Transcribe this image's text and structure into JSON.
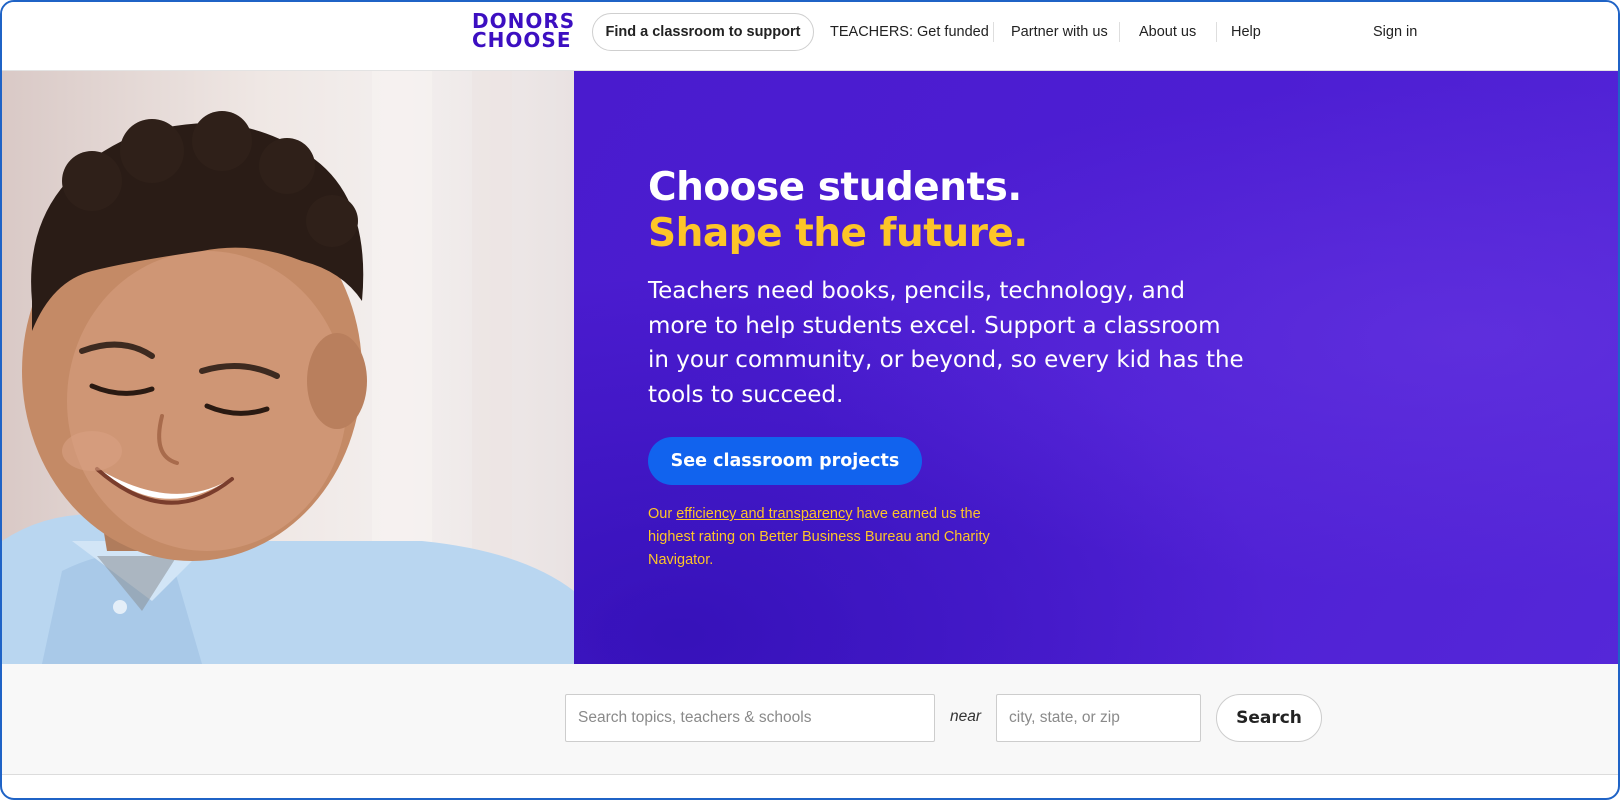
{
  "brand": {
    "logo_line1": "DONORS",
    "logo_line2": "CHOOSE",
    "color": "#3c0fc1"
  },
  "nav": {
    "find_classroom": "Find a classroom to support",
    "teachers": "TEACHERS: Get funded",
    "partner": "Partner with us",
    "about": "About us",
    "help": "Help",
    "sign_in": "Sign in"
  },
  "hero": {
    "title_line1": "Choose students.",
    "title_line2": "Shape the future.",
    "body": "Teachers need books, pencils, technology, and more to help students excel. Support a classroom in your community, or beyond, so every kid has the tools to succeed.",
    "cta_label": "See classroom projects",
    "note_prefix": "Our ",
    "note_link": "efficiency and transparency",
    "note_suffix": " have earned us the highest rating on Better Business Bureau and Charity Navigator.",
    "photo_icon": "child-smiling-photo",
    "colors": {
      "panel": "#4d1ed3",
      "accent": "#fdc528",
      "cta": "#1163ee"
    }
  },
  "search": {
    "topics_placeholder": "Search topics, teachers & schools",
    "near_label": "near",
    "location_placeholder": "city, state, or zip",
    "button_label": "Search"
  }
}
